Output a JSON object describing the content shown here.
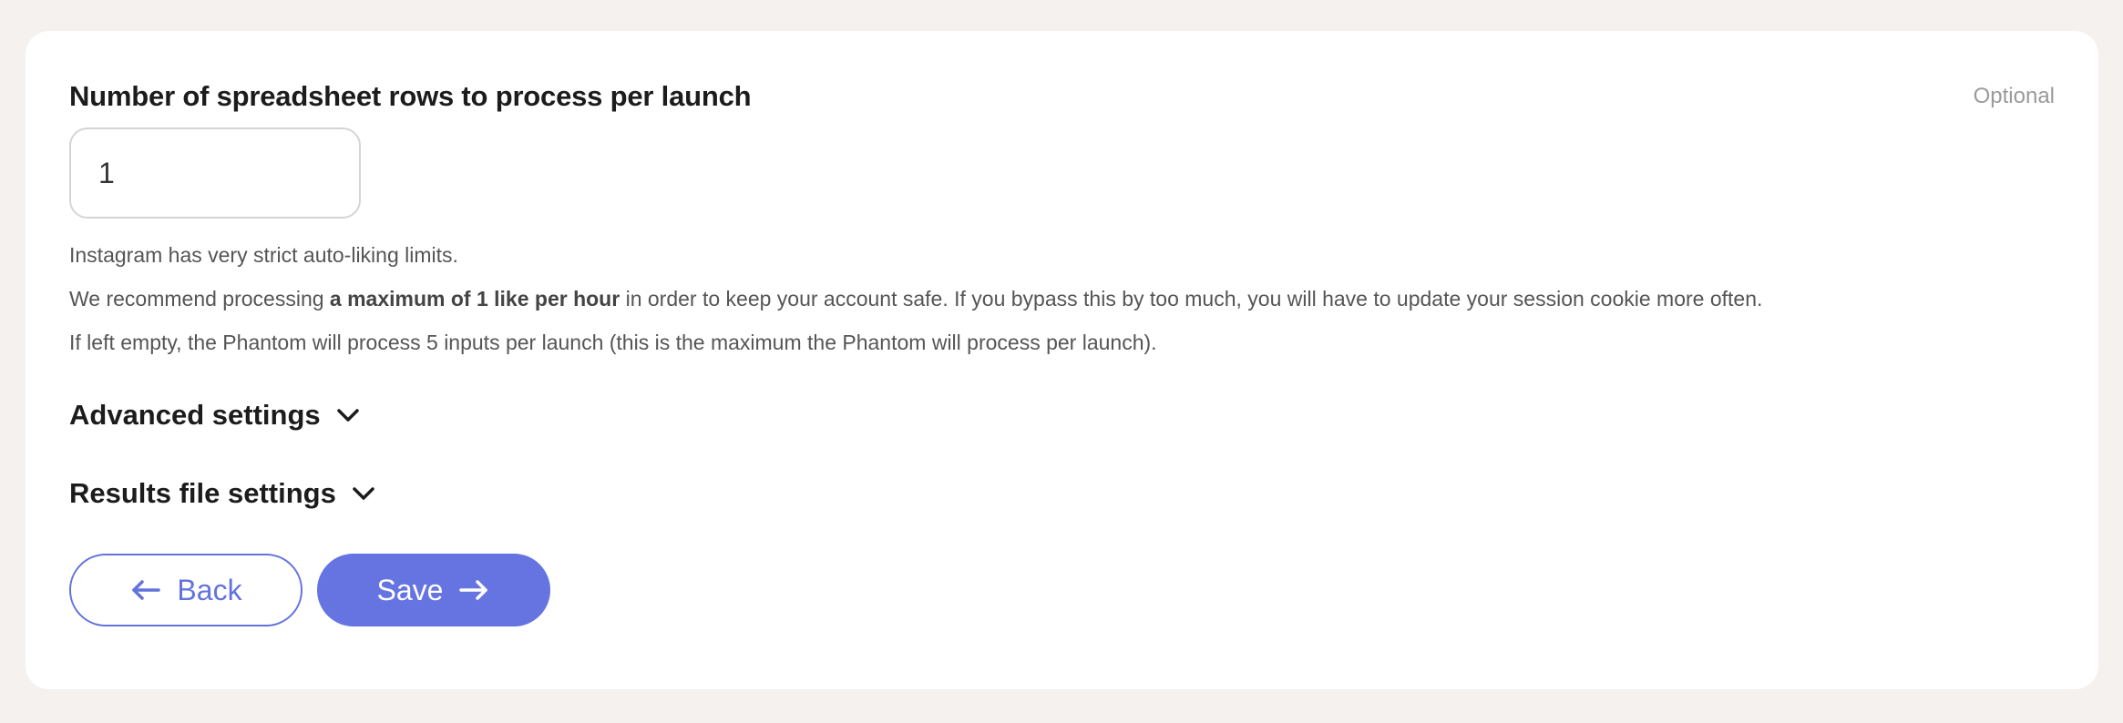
{
  "field": {
    "label": "Number of spreadsheet rows to process per launch",
    "optional": "Optional",
    "value": "1"
  },
  "help": {
    "line1": "Instagram has very strict auto-liking limits.",
    "line2_before": "We recommend processing ",
    "line2_bold": "a maximum of 1 like per hour",
    "line2_after": " in order to keep your account safe. If you bypass this by too much, you will have to update your session cookie more often.",
    "line3": "If left empty, the Phantom will process 5 inputs per launch (this is the maximum the Phantom will process per launch)."
  },
  "sections": {
    "advanced": "Advanced settings",
    "results": "Results file settings"
  },
  "buttons": {
    "back": "Back",
    "save": "Save"
  },
  "icons": {
    "chevron": "chevron-down-icon",
    "back_arrow": "arrow-left-icon",
    "save_arrow": "arrow-right-icon"
  },
  "colors": {
    "accent": "#6674e2",
    "page_bg": "#f4f1ee",
    "card_bg": "#ffffff",
    "muted_text": "#9a9a9a"
  }
}
